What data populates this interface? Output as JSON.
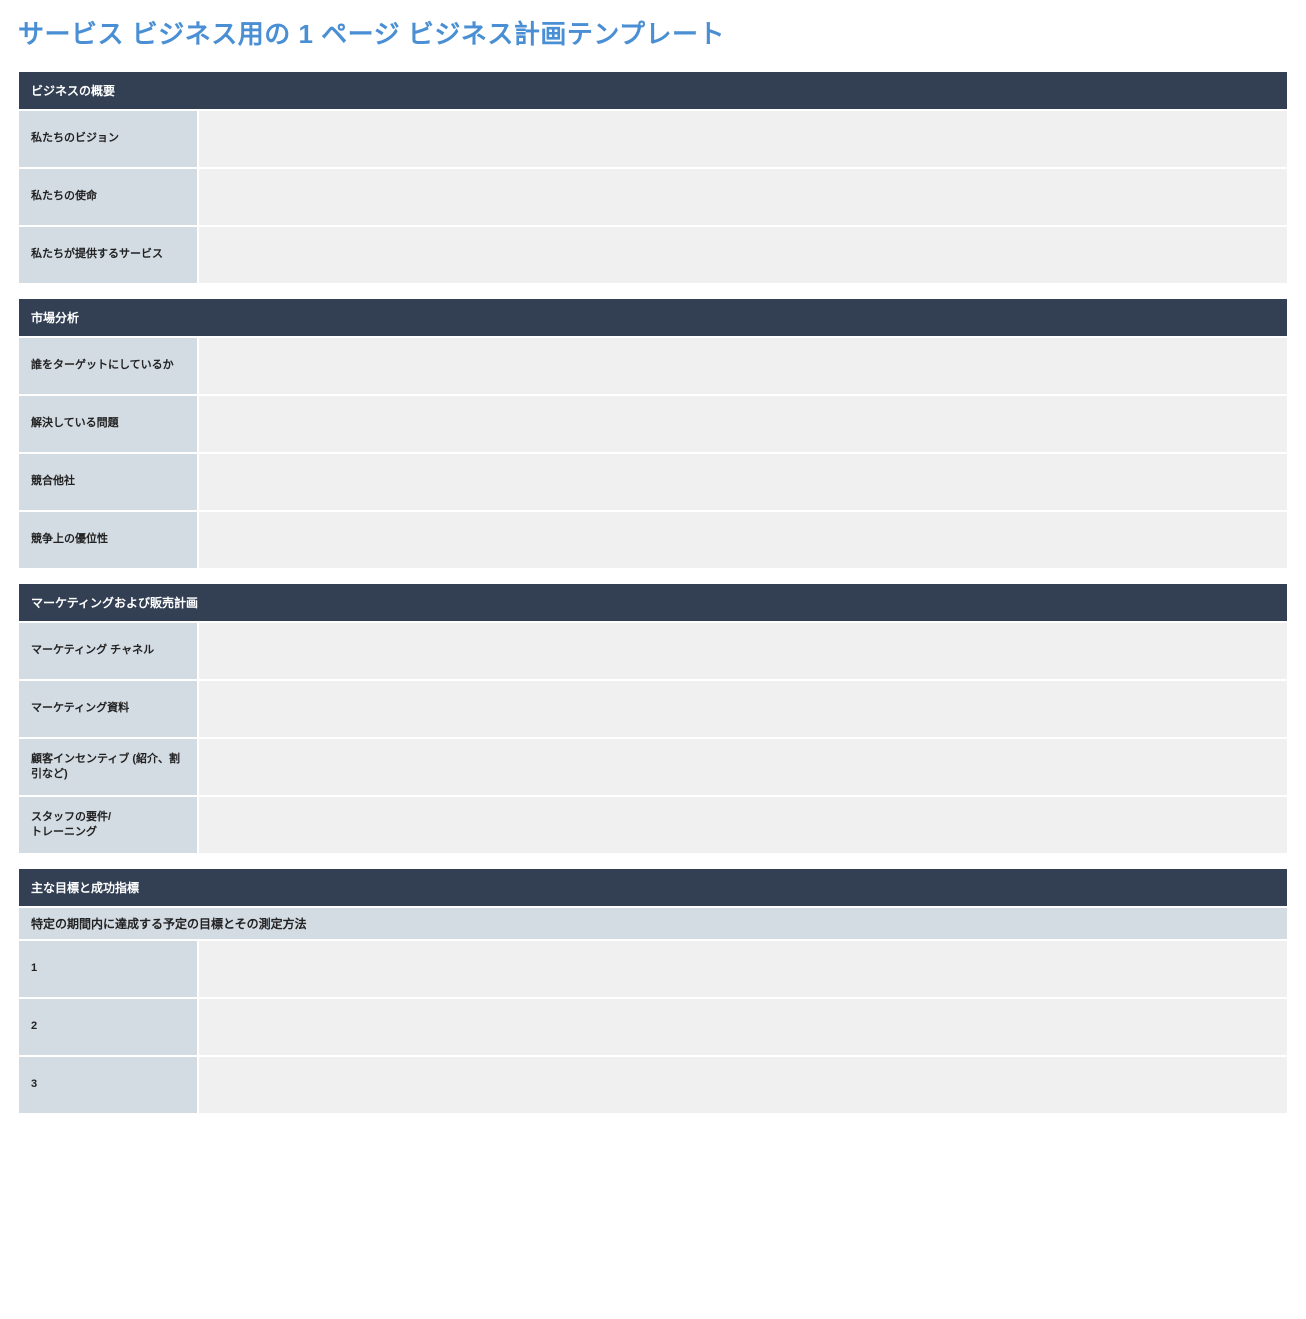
{
  "title": "サービス ビジネス用の 1 ページ ビジネス計画テンプレート",
  "sections": [
    {
      "header": "ビジネスの概要",
      "rows": [
        {
          "label": "私たちのビジョン",
          "value": ""
        },
        {
          "label": "私たちの使命",
          "value": ""
        },
        {
          "label": "私たちが提供するサービス",
          "value": ""
        }
      ]
    },
    {
      "header": "市場分析",
      "rows": [
        {
          "label": "誰をターゲットにしているか",
          "value": ""
        },
        {
          "label": "解決している問題",
          "value": ""
        },
        {
          "label": "競合他社",
          "value": ""
        },
        {
          "label": "競争上の優位性",
          "value": ""
        }
      ]
    },
    {
      "header": "マーケティングおよび販売計画",
      "rows": [
        {
          "label": "マーケティング チャネル",
          "value": ""
        },
        {
          "label": "マーケティング資料",
          "value": ""
        },
        {
          "label": "顧客インセンティブ (紹介、割引など)",
          "value": ""
        },
        {
          "label": "スタッフの要件/\nトレーニング",
          "value": ""
        }
      ]
    },
    {
      "header": "主な目標と成功指標",
      "subheader": "特定の期間内に達成する予定の目標とその測定方法",
      "rows": [
        {
          "label": "1",
          "value": ""
        },
        {
          "label": "2",
          "value": ""
        },
        {
          "label": "3",
          "value": ""
        }
      ]
    }
  ]
}
